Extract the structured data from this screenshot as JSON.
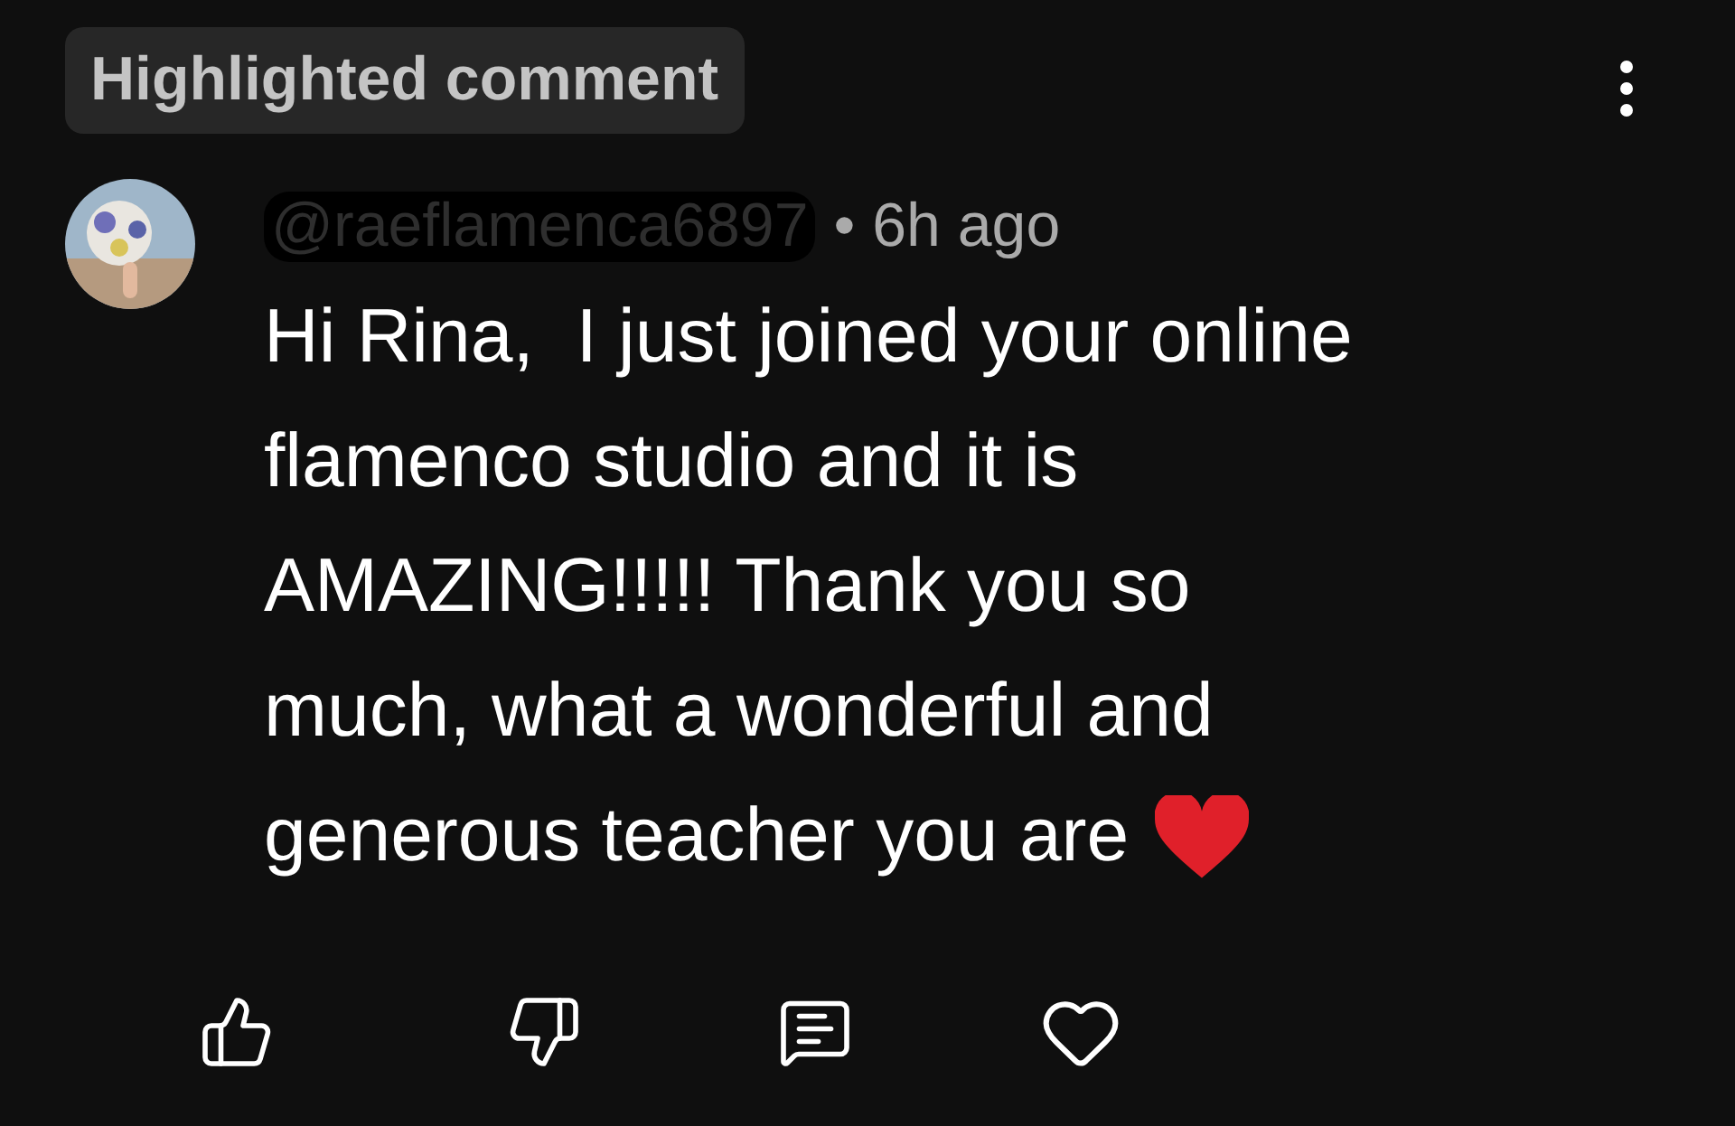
{
  "badge": "Highlighted comment",
  "comment": {
    "author": "@raeflamenca6897",
    "author_redacted": true,
    "time": "• 6h ago",
    "text": "Hi Rina,  I just joined your online flamenco studio and it is AMAZING!!!!! Thank you so much, what a wonderful and generous teacher you are",
    "liked": false,
    "hearted": false
  }
}
